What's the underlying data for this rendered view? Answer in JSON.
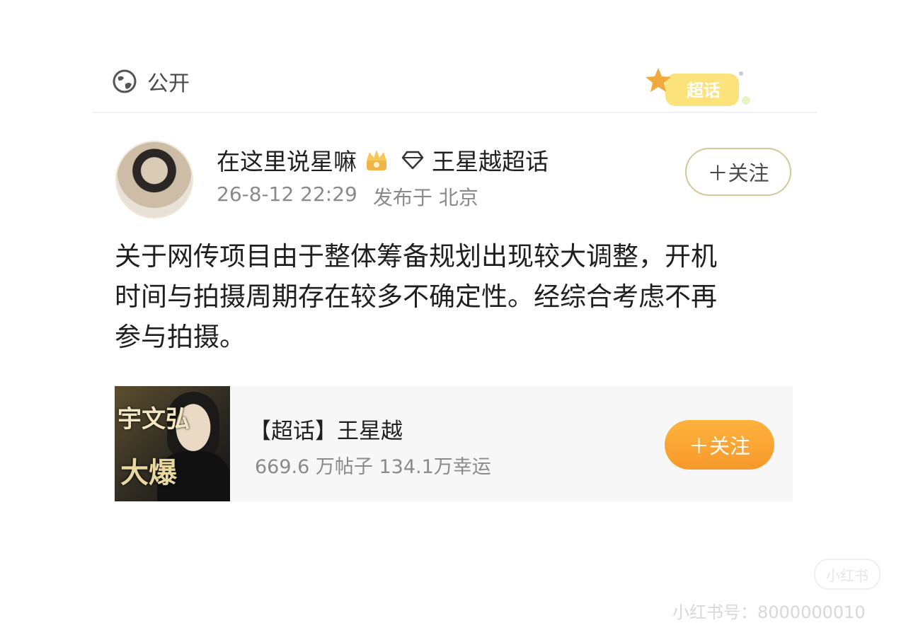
{
  "visibility": {
    "label": "公开",
    "icon": "globe-icon"
  },
  "badge": {
    "text": "超话",
    "color": "#f7c948"
  },
  "post": {
    "author": "在这里说星嘛",
    "topic": "王星越超话",
    "time": "26-8-12 22:29",
    "location": "发布于 北京",
    "follow_label": "＋关注",
    "body_lines": [
      "关于网传项目由于整体筹备规划出现较大调整，开机",
      "时间与拍摄周期存在较多不确定性。经综合考虑不再",
      "参与拍摄。"
    ]
  },
  "card": {
    "title": "【超话】王星越",
    "stats": "669.6 万帖子 134.1万幸运",
    "follow_label": "＋关注",
    "cover_text_top": "宇文弘",
    "cover_text_bottom": "大爆",
    "accent": "#f6992a"
  },
  "watermark": {
    "logo_text": "小红书",
    "id_text": "小红书号：8000000010"
  }
}
